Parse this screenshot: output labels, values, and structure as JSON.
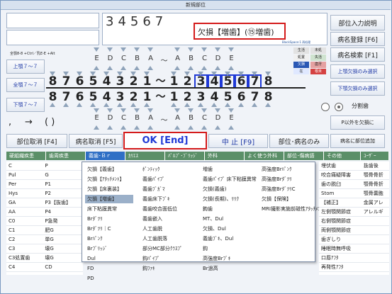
{
  "window": {
    "title": "新規部位"
  },
  "header": {
    "code": "34567",
    "status_text": "欠損【増歯】(⑮増歯)",
    "small_note": "BlockSpace:1 再処理",
    "shortcut_hint1": "全顎8-8 +Ctrl／乳E-E +Alt"
  },
  "right_buttons": {
    "part_input_desc": "部位入力説明",
    "register_disease": "病名登録 [F6]",
    "search_disease": "病名検索 [F1]",
    "upper_only": "上顎欠損のみ選択",
    "lower_only": "下顎欠損のみ選択",
    "split_teeth": "分割歯",
    "p_other": "P以外を欠損に"
  },
  "legend": {
    "labels": [
      "生活",
      "未処",
      "処置",
      "失活",
      "欠損",
      "歯牙",
      "在",
      "根未"
    ]
  },
  "jaw_labels": {
    "upper": "上顎７～７",
    "full": "全顎７～７",
    "lower": "下顎７～７"
  },
  "letters_top": [
    "E",
    "D",
    "C",
    "B",
    "A",
    "～",
    "A",
    "B",
    "C",
    "D",
    "E"
  ],
  "letters_bottom": [
    "E",
    "D",
    "C",
    "B",
    "A",
    "～",
    "A",
    "B",
    "C",
    "D",
    "E"
  ],
  "upper_row": [
    "8",
    "7",
    "6",
    "5",
    "4",
    "3",
    "2",
    "1",
    "～",
    "1",
    "2",
    "3",
    "4",
    "5",
    "6",
    "7",
    "8"
  ],
  "lower_row": [
    "8",
    "7",
    "6",
    "5",
    "4",
    "3",
    "2",
    "1",
    "～",
    "1",
    "2",
    "3",
    "4",
    "5",
    "6",
    "7",
    "8"
  ],
  "upper_selected": [
    11,
    12,
    13,
    14,
    15
  ],
  "symbols": {
    "comma": ",",
    "arrow": "→",
    "paren": "( )"
  },
  "action_buttons": {
    "cancel_part": "部位取消 [F4]",
    "cancel_disease": "病名取消 [F5]",
    "ok": "OK [End]",
    "abort": "中 止 [F9]",
    "part_disease": "部位･病名のみ",
    "add_part": "病名に部位追加"
  },
  "tabs": [
    "硬組織疾患",
    "歯周疾患",
    "義歯･Ｂｒ",
    "ｶﾘｴｽ",
    "ﾊﾟﾙﾌﾟ･ﾌﾞﾘｯｼﾞ",
    "外科",
    "よく使う外科",
    "部位･傷病語",
    "その他",
    "ﾕｰｻﾞｰ"
  ],
  "left_table": [
    [
      "C",
      "P"
    ],
    [
      "Pul",
      "G"
    ],
    [
      "Per",
      "P1"
    ],
    [
      "Hys",
      "P2"
    ],
    [
      "GA",
      "P3【抜歯】"
    ],
    [
      "AA",
      "P4"
    ],
    [
      "C0",
      "P急発"
    ],
    [
      "C1",
      "肥G"
    ],
    [
      "C2",
      "単G"
    ],
    [
      "C3",
      "壊G"
    ],
    [
      "C3処置歯",
      "壊G"
    ],
    [
      "C4",
      "CD"
    ]
  ],
  "dropdown_col1": [
    "欠損【義歯】",
    "欠損【ｱﾀｯﾁﾒﾝﾄ】",
    "欠損【床裏装】",
    "欠損【増歯】",
    "床下粘膜異常",
    "Brﾀﾞﾂﾘ",
    "Brﾀﾞﾂﾘ｜C",
    "Brﾊﾟﾝｸ",
    "Brﾌﾞﾘｯｼﾞ",
    "Dul",
    "FD",
    "PD"
  ],
  "dropdown_col2": [
    "ﾎﾟﾝﾃｨｯｸ",
    "義歯ﾊﾟｲﾌﾟ",
    "義歯ﾌﾞｶﾞﾏ",
    "義歯床下ﾌﾞｷ",
    "義歯咬合面低位",
    "義歯嵌入",
    "人工歯脱",
    "人工歯脱落",
    "部分MC部分ｸﾗｽﾌﾟ",
    "鈎ﾊﾟｲﾌﾟ",
    "鈎ﾌｧｷ"
  ],
  "dropdown_col3": [
    "増歯",
    "義歯ﾊﾟｲﾌﾟ 床下粘膜異常",
    "欠損(義歯)",
    "欠損(長期)、ﾘﾘｸ",
    "鉤歯",
    "MT、Dul",
    "欠損、Dul",
    "義歯ﾌﾞｷ、Dul",
    "鈎",
    "高強度Brﾌﾞｷ",
    "Br過高"
  ],
  "dropdown_col4": [
    "高強度Brﾊﾟﾝｸ",
    "高強度Brﾀﾞﾂﾘ",
    "高強度BrﾀﾞﾂﾘC",
    "欠損【保険】",
    "MRI撮影実施前磁性ｱﾀｯﾁﾒﾝﾄ"
  ],
  "right_table": [
    [
      "埋伏歯",
      "抜歯後"
    ],
    [
      "咬合痛疑障害",
      "顎骨骨折"
    ],
    [
      "歯の脱臼",
      "顎骨骨折"
    ],
    [
      "Stom",
      "顎骨嚢胞"
    ],
    [
      "【補正】",
      "金属アレ"
    ],
    [
      "左側顎関節症",
      "アレルギ"
    ],
    [
      "右側顎関節症",
      ""
    ],
    [
      "両側顎関節症",
      ""
    ],
    [
      "歯ぎしり",
      ""
    ],
    [
      "睡眠時無呼吸",
      ""
    ],
    [
      "口唇ｱﾌﾀ",
      ""
    ],
    [
      "再発性ｱﾌﾀ",
      ""
    ]
  ],
  "colors": {
    "tab_bg": "#5b8f68",
    "tab_active": "#2f6fc5",
    "selected_row": "#9bb0c9",
    "red": "#d41b1b",
    "blue": "#1f39d6"
  }
}
